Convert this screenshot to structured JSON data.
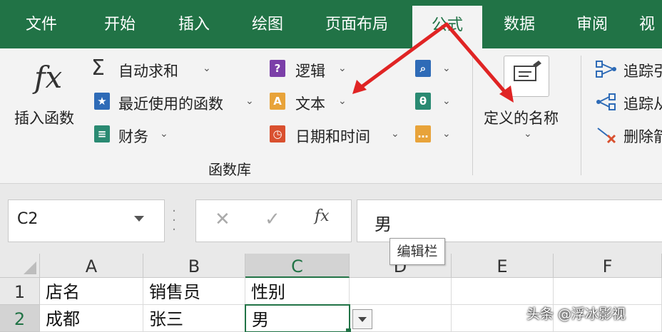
{
  "tabs": [
    "文件",
    "开始",
    "插入",
    "绘图",
    "页面布局",
    "公式",
    "数据",
    "审阅",
    "视"
  ],
  "active_tab": "公式",
  "ribbon": {
    "insert_function": "插入函数",
    "autosum": "自动求和",
    "recent": "最近使用的函数",
    "finance": "财务",
    "logic": "逻辑",
    "text": "文本",
    "datetime": "日期和时间",
    "group_label": "函数库",
    "defined_names": "定义的名称",
    "trace_precedents": "追踪引",
    "trace_dependents": "追踪从",
    "remove_arrows": "删除箭"
  },
  "formula_bar": {
    "name_box": "C2",
    "value": "男",
    "tooltip": "编辑栏"
  },
  "columns": [
    "A",
    "B",
    "C",
    "D",
    "E",
    "F"
  ],
  "rows": [
    {
      "num": "1",
      "cells": [
        "店名",
        "销售员",
        "性别",
        "",
        "",
        ""
      ]
    },
    {
      "num": "2",
      "cells": [
        "成都",
        "张三",
        "男",
        "",
        "",
        ""
      ]
    }
  ],
  "watermark": "头条 @浮冰影视",
  "colors": {
    "tab_green": "#217346",
    "arrow_red": "#e02424",
    "icon_blue": "#2e6bb7",
    "icon_purple": "#7b3fa8",
    "icon_orange": "#e8a33a",
    "icon_red": "#d9502f",
    "icon_teal": "#2a8a72"
  }
}
